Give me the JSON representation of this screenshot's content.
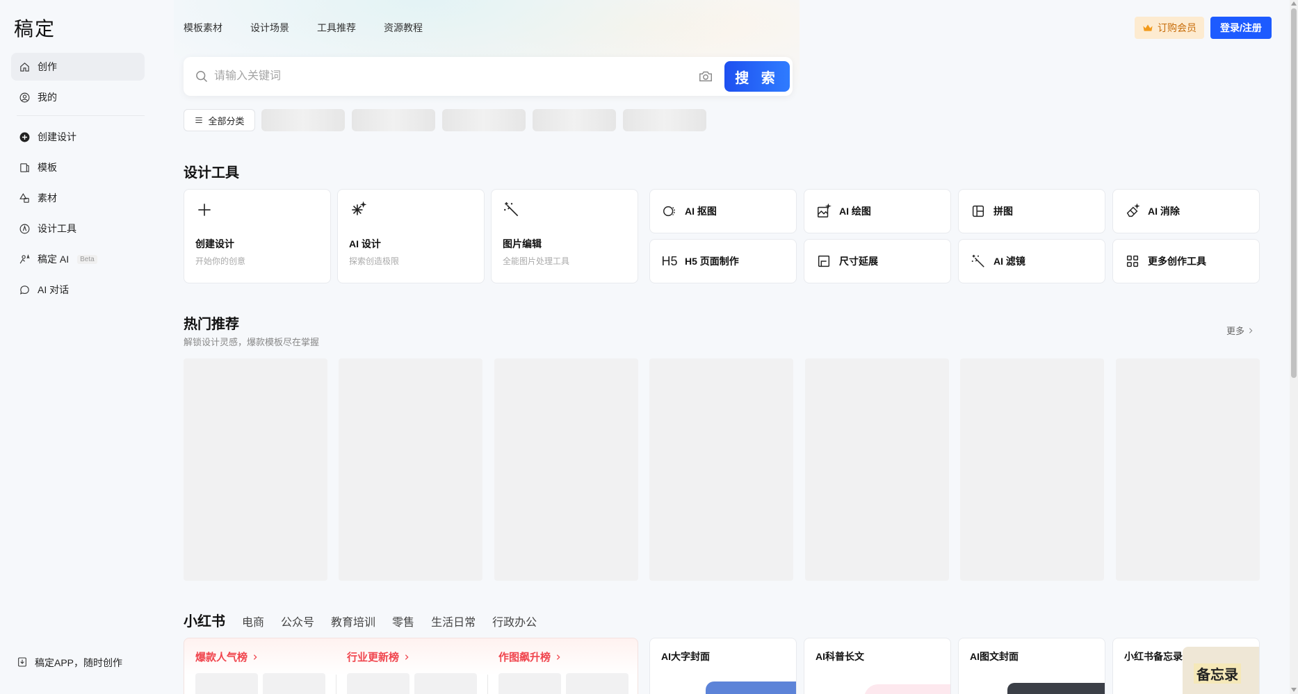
{
  "sidebar": {
    "logo": "稿定",
    "items": [
      {
        "label": "创作"
      },
      {
        "label": "我的"
      },
      {
        "label": "创建设计"
      },
      {
        "label": "模板"
      },
      {
        "label": "素材"
      },
      {
        "label": "设计工具"
      },
      {
        "label": "稿定 AI",
        "badge": "Beta"
      },
      {
        "label": "AI 对话"
      }
    ],
    "app_link": "稿定APP，随时创作"
  },
  "topnav": {
    "items": [
      "模板素材",
      "设计场景",
      "工具推荐",
      "资源教程"
    ],
    "vip_label": "订购会员",
    "login_label": "登录/注册"
  },
  "search": {
    "placeholder": "请输入关键词",
    "button_label": "搜 索"
  },
  "categories": {
    "all_label": "全部分类"
  },
  "design_tools": {
    "title": "设计工具",
    "big_cards": [
      {
        "title": "创建设计",
        "desc": "开始你的创意",
        "icon": "plus-icon"
      },
      {
        "title": "AI 设计",
        "desc": "探索创造极限",
        "icon": "sparkle-icon"
      },
      {
        "title": "图片编辑",
        "desc": "全能图片处理工具",
        "icon": "magic-wand-icon"
      }
    ],
    "small_cards": [
      {
        "label": "AI 抠图",
        "icon": "cutout-icon"
      },
      {
        "label": "AI 绘图",
        "icon": "ai-draw-icon"
      },
      {
        "label": "拼图",
        "icon": "collage-icon"
      },
      {
        "label": "AI 消除",
        "icon": "eraser-icon"
      },
      {
        "label": "H5 页面制作",
        "icon": "H5"
      },
      {
        "label": "尺寸延展",
        "icon": "resize-icon"
      },
      {
        "label": "AI 滤镜",
        "icon": "filter-icon"
      },
      {
        "label": "更多创作工具",
        "icon": "grid-icon"
      }
    ]
  },
  "hot": {
    "title": "热门推荐",
    "subtitle": "解锁设计灵感，爆款模板尽在掌握",
    "more_label": "更多"
  },
  "scene_tabs": [
    "小红书",
    "电商",
    "公众号",
    "教育培训",
    "零售",
    "生活日常",
    "行政办公"
  ],
  "rankings": [
    "爆款人气榜",
    "行业更新榜",
    "作图飙升榜"
  ],
  "xhs_cards": [
    {
      "title": "AI大字封面"
    },
    {
      "title": "AI科普长文"
    },
    {
      "title": "AI图文封面"
    },
    {
      "title": "小红书备忘录",
      "image_text": "备忘录"
    }
  ],
  "colors": {
    "accent": "#1d5bff",
    "vip_bg": "#fdebd0",
    "vip_text": "#c66b08",
    "ranking_red": "#f0454e"
  }
}
